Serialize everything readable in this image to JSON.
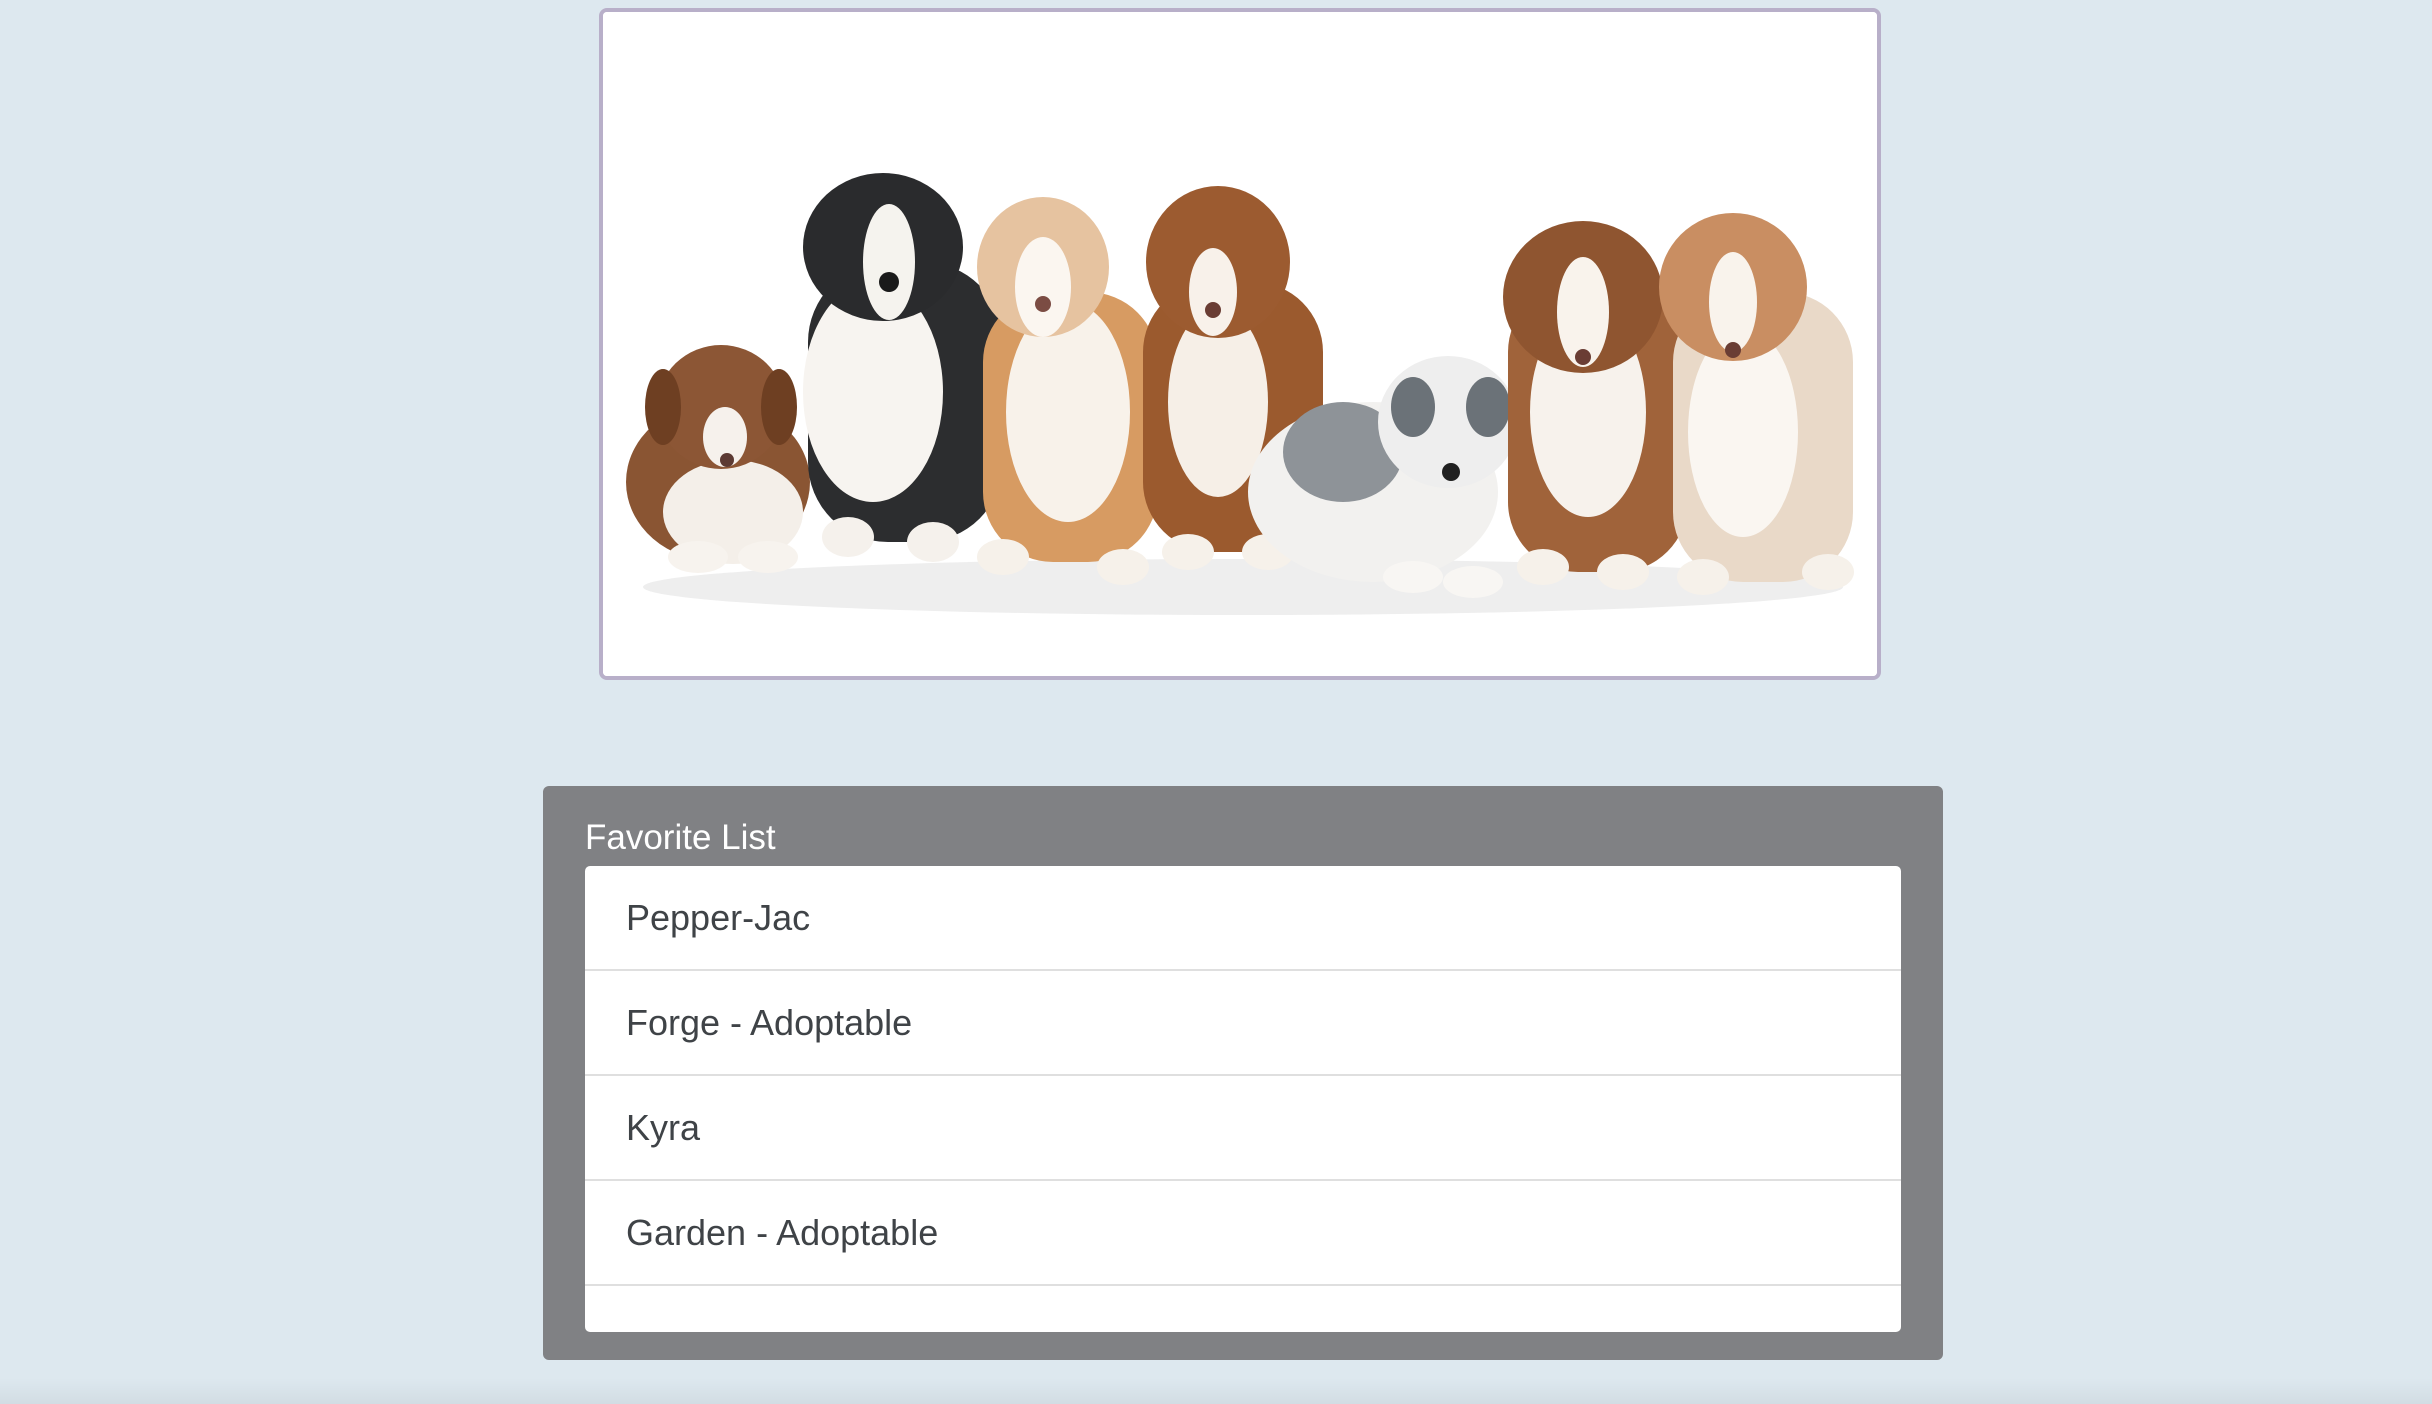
{
  "hero": {
    "image_alt": "seven australian shepherd puppies"
  },
  "favorites": {
    "title": "Favorite List",
    "items": [
      {
        "label": "Pepper-Jac"
      },
      {
        "label": "Forge - Adoptable"
      },
      {
        "label": "Kyra"
      },
      {
        "label": "Garden - Adoptable"
      }
    ]
  },
  "colors": {
    "background": "#dde8ef",
    "panel": "#808184",
    "hero_border": "#b8afc9"
  }
}
